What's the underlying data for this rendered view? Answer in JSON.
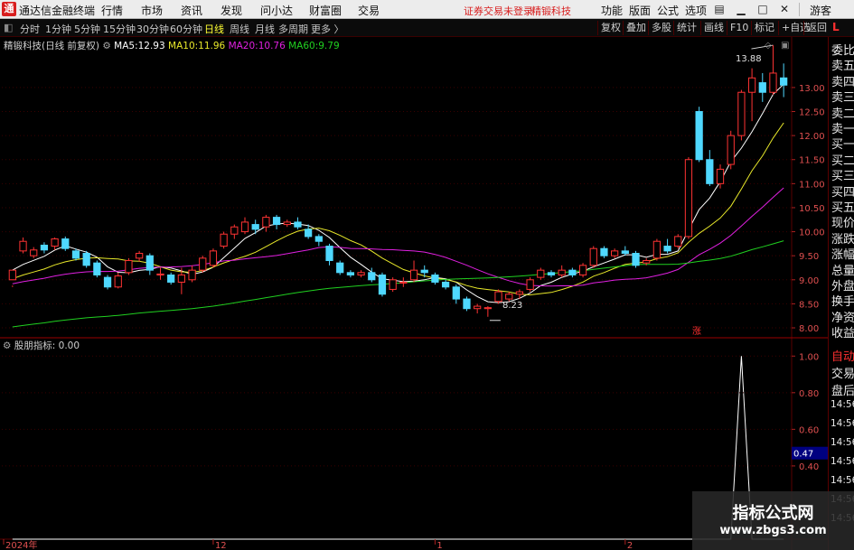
{
  "menubar": {
    "app_title": "通达信金融终端",
    "items": [
      "行情",
      "市场",
      "资讯",
      "发现",
      "问小达",
      "财富圈",
      "交易"
    ],
    "notice": "证券交易未登录",
    "stock_name": "精锻科技",
    "right_items": [
      "功能",
      "版面",
      "公式",
      "选项"
    ],
    "guest": "游客"
  },
  "toolbar": {
    "periods": [
      "分时",
      "1分钟",
      "5分钟",
      "15分钟",
      "30分钟",
      "60分钟",
      "日线",
      "周线",
      "月线",
      "多周期",
      "更多"
    ],
    "active_period": "日线",
    "buttons": [
      "复权",
      "叠加",
      "多股",
      "统计",
      "画线",
      "F10",
      "标记",
      "+自选",
      "返回"
    ],
    "right_badge": "L"
  },
  "main_chart": {
    "title": "精锻科技(日线 前复权)",
    "ma": [
      {
        "label": "MA5:",
        "value": "12.93",
        "color": "#ffffff"
      },
      {
        "label": "MA10:",
        "value": "11.96",
        "color": "#e8e82a"
      },
      {
        "label": "MA20:",
        "value": "10.76",
        "color": "#e020e0"
      },
      {
        "label": "MA60:",
        "value": "9.79",
        "color": "#20d020"
      }
    ],
    "y_ticks": [
      "13.00",
      "12.50",
      "12.00",
      "11.50",
      "11.00",
      "10.50",
      "10.00",
      "9.50",
      "9.00",
      "8.50",
      "8.00"
    ],
    "high_label": "13.88",
    "low_label": "8.23",
    "limit_up_mark": "涨"
  },
  "indicator": {
    "name": "股朋指标",
    "value_text": ": 0.00",
    "y_ticks": [
      "1.00",
      "0.80",
      "0.60",
      "0.40"
    ],
    "current_value": "0.47"
  },
  "x_axis": {
    "labels": [
      "2024年",
      "12",
      "1",
      "2"
    ]
  },
  "quote_panel": {
    "labels": [
      "委比",
      "卖五",
      "卖四",
      "卖三",
      "卖二",
      "卖一",
      "买一",
      "买二",
      "买三",
      "买四",
      "买五",
      "现价",
      "涨跌",
      "涨幅",
      "总量",
      "外盘",
      "换手",
      "净资",
      "收益"
    ],
    "lower_labels": [
      "自动",
      "交易",
      "盘后"
    ],
    "times": [
      "14:56",
      "14:56",
      "14:56",
      "14:56",
      "14:56",
      "14:56",
      "14:56"
    ]
  },
  "watermark": {
    "title": "指标公式网",
    "url": "www.zbgs3.com"
  },
  "chart_data": {
    "type": "candlestick",
    "x_labels": [
      "2024年",
      "12",
      "1",
      "2"
    ],
    "ylim": [
      7.85,
      13.9
    ],
    "candles": [
      [
        9.0,
        9.2,
        8.88,
        8.85
      ],
      [
        9.6,
        9.8,
        9.88,
        9.55
      ],
      [
        9.5,
        9.62,
        9.68,
        9.45
      ],
      [
        9.72,
        9.62,
        9.78,
        9.55
      ],
      [
        9.7,
        9.85,
        9.88,
        9.62
      ],
      [
        9.85,
        9.65,
        9.9,
        9.6
      ],
      [
        9.6,
        9.45,
        9.65,
        9.4
      ],
      [
        9.55,
        9.3,
        9.6,
        9.25
      ],
      [
        9.35,
        9.1,
        9.4,
        9.05
      ],
      [
        9.05,
        8.85,
        9.1,
        8.8
      ],
      [
        8.85,
        9.08,
        9.15,
        8.82
      ],
      [
        9.15,
        9.4,
        9.45,
        9.1
      ],
      [
        9.45,
        9.55,
        9.6,
        9.38
      ],
      [
        9.5,
        9.2,
        9.55,
        9.1
      ],
      [
        9.1,
        9.12,
        9.25,
        9.0
      ],
      [
        9.1,
        8.95,
        9.15,
        8.9
      ],
      [
        8.95,
        9.1,
        9.25,
        8.7
      ],
      [
        9.0,
        9.2,
        9.3,
        8.95
      ],
      [
        9.2,
        9.45,
        9.5,
        9.15
      ],
      [
        9.3,
        9.6,
        9.65,
        9.25
      ],
      [
        9.7,
        9.95,
        10.0,
        9.65
      ],
      [
        9.95,
        10.1,
        10.15,
        9.85
      ],
      [
        10.0,
        10.2,
        10.3,
        9.95
      ],
      [
        10.15,
        10.05,
        10.25,
        9.95
      ],
      [
        10.1,
        10.3,
        10.35,
        10.0
      ],
      [
        10.3,
        10.15,
        10.35,
        10.05
      ],
      [
        10.15,
        10.2,
        10.25,
        10.1
      ],
      [
        10.2,
        10.1,
        10.3,
        10.05
      ],
      [
        10.05,
        9.9,
        10.15,
        9.85
      ],
      [
        9.9,
        9.8,
        9.95,
        9.7
      ],
      [
        9.7,
        9.4,
        9.75,
        9.3
      ],
      [
        9.35,
        9.15,
        9.4,
        9.1
      ],
      [
        9.15,
        9.1,
        9.2,
        9.05
      ],
      [
        9.1,
        9.15,
        9.2,
        9.05
      ],
      [
        9.15,
        9.0,
        9.25,
        8.95
      ],
      [
        9.1,
        8.7,
        9.15,
        8.65
      ],
      [
        8.8,
        9.0,
        9.05,
        8.75
      ],
      [
        8.95,
        8.95,
        9.05,
        8.85
      ],
      [
        9.0,
        9.2,
        9.4,
        8.95
      ],
      [
        9.2,
        9.15,
        9.3,
        9.05
      ],
      [
        9.1,
        8.95,
        9.15,
        8.9
      ],
      [
        8.95,
        8.85,
        9.0,
        8.8
      ],
      [
        8.85,
        8.6,
        8.9,
        8.5
      ],
      [
        8.6,
        8.4,
        8.65,
        8.35
      ],
      [
        8.4,
        8.45,
        8.5,
        8.3
      ],
      [
        8.4,
        8.42,
        8.45,
        8.23
      ],
      [
        8.55,
        8.75,
        8.8,
        8.5
      ],
      [
        8.6,
        8.7,
        8.75,
        8.55
      ],
      [
        8.7,
        8.75,
        8.8,
        8.6
      ],
      [
        8.8,
        9.0,
        9.05,
        8.75
      ],
      [
        9.05,
        9.2,
        9.25,
        9.0
      ],
      [
        9.15,
        9.1,
        9.2,
        9.05
      ],
      [
        9.1,
        9.2,
        9.3,
        9.05
      ],
      [
        9.2,
        9.1,
        9.25,
        9.05
      ],
      [
        9.1,
        9.3,
        9.35,
        9.05
      ],
      [
        9.3,
        9.65,
        9.7,
        9.25
      ],
      [
        9.65,
        9.5,
        9.7,
        9.45
      ],
      [
        9.5,
        9.6,
        9.65,
        9.45
      ],
      [
        9.6,
        9.55,
        9.7,
        9.5
      ],
      [
        9.55,
        9.3,
        9.6,
        9.25
      ],
      [
        9.35,
        9.4,
        9.45,
        9.3
      ],
      [
        9.45,
        9.8,
        9.85,
        9.4
      ],
      [
        9.7,
        9.6,
        9.85,
        9.55
      ],
      [
        9.7,
        9.9,
        9.95,
        9.65
      ],
      [
        9.9,
        11.5,
        11.55,
        9.85
      ],
      [
        12.5,
        11.5,
        12.6,
        11.45
      ],
      [
        11.5,
        11.0,
        11.7,
        10.95
      ],
      [
        11.0,
        11.3,
        11.4,
        10.9
      ],
      [
        11.4,
        12.0,
        12.1,
        11.3
      ],
      [
        12.0,
        12.9,
        12.95,
        11.9
      ],
      [
        12.9,
        13.2,
        13.4,
        12.3
      ],
      [
        13.1,
        12.9,
        13.3,
        12.7
      ],
      [
        12.9,
        13.3,
        13.88,
        12.85
      ],
      [
        13.2,
        13.05,
        13.5,
        12.8
      ]
    ],
    "indicator_values": [
      0,
      0,
      0,
      0,
      0,
      0,
      0,
      0,
      0,
      0,
      0,
      0,
      0,
      0,
      0,
      0,
      0,
      0,
      0,
      0,
      0,
      0,
      0,
      0,
      0,
      0,
      0,
      0,
      0,
      0,
      0,
      0,
      0,
      0,
      0,
      0,
      0,
      0,
      0,
      0,
      0,
      0,
      0,
      0,
      0,
      0,
      0,
      0,
      0,
      0,
      0,
      0,
      0,
      0,
      0,
      0,
      0,
      0,
      0,
      0,
      0,
      0,
      0,
      0,
      0,
      0,
      0,
      0,
      0,
      1,
      0,
      0,
      0,
      0
    ],
    "indicator_ylim": [
      0,
      1.1
    ],
    "colors": {
      "up": "#ff3333",
      "down": "#4fd8ff",
      "ma5": "#ffffff",
      "ma10": "#e8e82a",
      "ma20": "#e020e0",
      "ma60": "#20d020",
      "grid": "#5a0000"
    }
  }
}
